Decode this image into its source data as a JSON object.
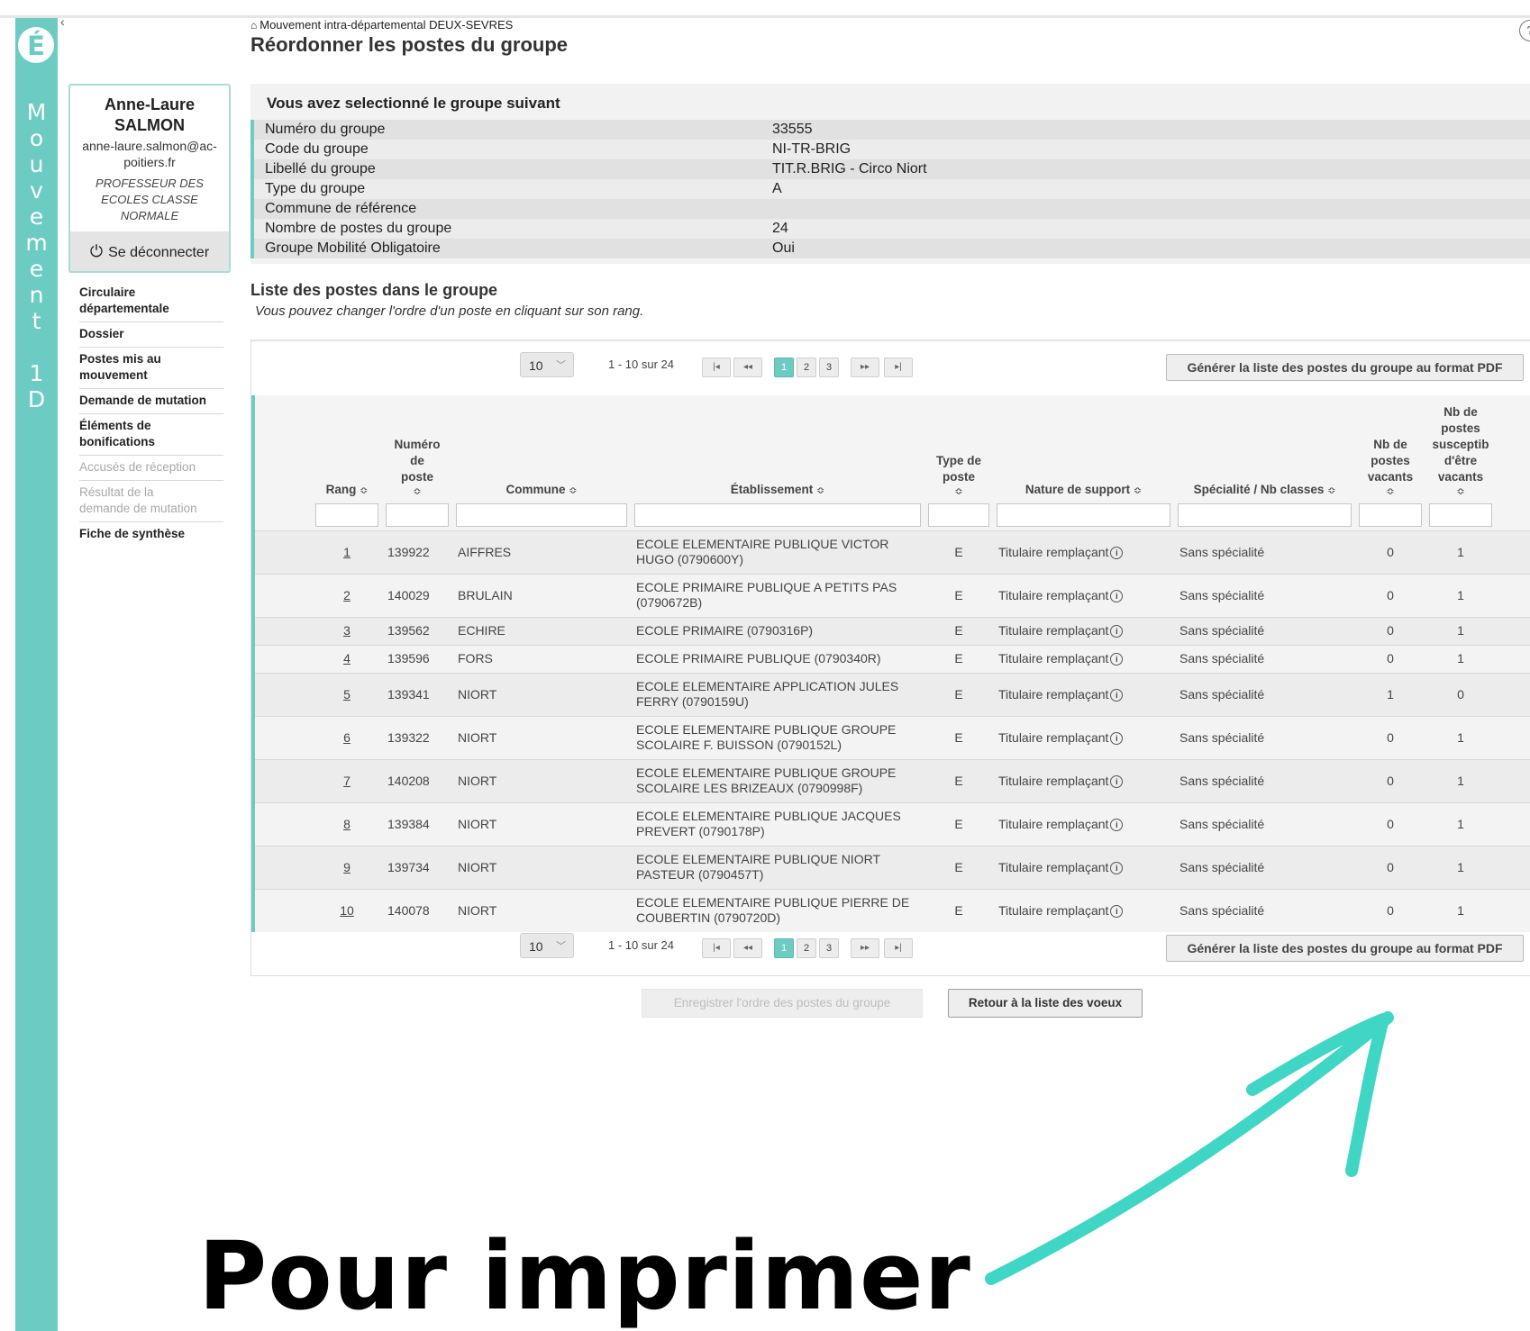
{
  "sidebar": {
    "logo": "É",
    "vertical_letters": [
      "M",
      "o",
      "u",
      "v",
      "e",
      "m",
      "e",
      "n",
      "t",
      "",
      "1",
      "D"
    ],
    "collapse_label": "‹",
    "user": {
      "first_name": "Anne-Laure",
      "last_name": "SALMON",
      "email_line1": "anne-laure.salmon@ac-",
      "email_line2": "poitiers.fr",
      "role_line1": "PROFESSEUR DES",
      "role_line2": "ECOLES CLASSE",
      "role_line3": "NORMALE",
      "logout_label": "Se déconnecter"
    },
    "nav": [
      {
        "line1": "Circulaire",
        "line2": "départementale"
      },
      {
        "line1": "Dossier",
        "line2": ""
      },
      {
        "line1": "Postes mis au",
        "line2": "mouvement"
      },
      {
        "line1": "Demande de mutation",
        "line2": ""
      },
      {
        "line1": "Éléments de",
        "line2": "bonifications"
      },
      {
        "line1": "Accusés de réception",
        "line2": ""
      },
      {
        "line1": "Résultat de la",
        "line2": "demande de mutation"
      },
      {
        "line1": "Fiche de synthèse",
        "line2": ""
      }
    ]
  },
  "header": {
    "breadcrumb": "Mouvement intra-départemental DEUX-SEVRES",
    "title": "Réordonner les postes du groupe",
    "help": "?"
  },
  "group": {
    "heading": "Vous avez selectionné le groupe suivant",
    "rows": [
      {
        "label": "Numéro du groupe",
        "value": "33555"
      },
      {
        "label": "Code du groupe",
        "value": "NI-TR-BRIG"
      },
      {
        "label": "Libellé du groupe",
        "value": "TIT.R.BRIG - Circo Niort"
      },
      {
        "label": "Type du groupe",
        "value": "A"
      },
      {
        "label": "Commune de référence",
        "value": ""
      },
      {
        "label": "Nombre de postes du groupe",
        "value": "24"
      },
      {
        "label": "Groupe Mobilité Obligatoire",
        "value": "Oui"
      }
    ]
  },
  "list": {
    "title": "Liste des postes dans le groupe",
    "subtitle": "Vous pouvez changer l'ordre d'un poste en cliquant sur son rang.",
    "pager": {
      "page_size": "10",
      "range_text": "1 - 10 sur 24",
      "pages": [
        "1",
        "2",
        "3"
      ],
      "first": "|◂",
      "prev": "◂◂",
      "next": "▸▸",
      "last": "▸|"
    },
    "pdf_button": "Générer la liste des postes du groupe au format PDF",
    "columns": {
      "rang": "Rang",
      "numero_l1": "Numéro",
      "numero_l2": "de",
      "numero_l3": "poste",
      "commune": "Commune",
      "etablissement": "Établissement",
      "type_l1": "Type de",
      "type_l2": "poste",
      "nature": "Nature de support",
      "specialite": "Spécialité / Nb classes",
      "vacants_l1": "Nb de",
      "vacants_l2": "postes",
      "vacants_l3": "vacants",
      "susc_l1": "Nb de",
      "susc_l2": "postes",
      "susc_l3": "susceptib",
      "susc_l4": "d'être",
      "susc_l5": "vacants",
      "sort_icon": "≎"
    },
    "rows": [
      {
        "rang": "1",
        "numero": "139922",
        "commune": "AIFFRES",
        "etab_l1": "ECOLE ELEMENTAIRE PUBLIQUE VICTOR",
        "etab_l2": "HUGO (0790600Y)",
        "type": "E",
        "nature": "Titulaire remplaçant",
        "specialite": "Sans spécialité",
        "vacants": "0",
        "susceptibles": "1"
      },
      {
        "rang": "2",
        "numero": "140029",
        "commune": "BRULAIN",
        "etab_l1": "ECOLE PRIMAIRE PUBLIQUE A PETITS PAS",
        "etab_l2": "(0790672B)",
        "type": "E",
        "nature": "Titulaire remplaçant",
        "specialite": "Sans spécialité",
        "vacants": "0",
        "susceptibles": "1"
      },
      {
        "rang": "3",
        "numero": "139562",
        "commune": "ECHIRE",
        "etab_l1": "ECOLE PRIMAIRE (0790316P)",
        "etab_l2": "",
        "type": "E",
        "nature": "Titulaire remplaçant",
        "specialite": "Sans spécialité",
        "vacants": "0",
        "susceptibles": "1"
      },
      {
        "rang": "4",
        "numero": "139596",
        "commune": "FORS",
        "etab_l1": "ECOLE PRIMAIRE PUBLIQUE (0790340R)",
        "etab_l2": "",
        "type": "E",
        "nature": "Titulaire remplaçant",
        "specialite": "Sans spécialité",
        "vacants": "0",
        "susceptibles": "1"
      },
      {
        "rang": "5",
        "numero": "139341",
        "commune": "NIORT",
        "etab_l1": "ECOLE ELEMENTAIRE APPLICATION JULES",
        "etab_l2": "FERRY (0790159U)",
        "type": "E",
        "nature": "Titulaire remplaçant",
        "specialite": "Sans spécialité",
        "vacants": "1",
        "susceptibles": "0"
      },
      {
        "rang": "6",
        "numero": "139322",
        "commune": "NIORT",
        "etab_l1": "ECOLE ELEMENTAIRE PUBLIQUE GROUPE",
        "etab_l2": "SCOLAIRE F. BUISSON (0790152L)",
        "type": "E",
        "nature": "Titulaire remplaçant",
        "specialite": "Sans spécialité",
        "vacants": "0",
        "susceptibles": "1"
      },
      {
        "rang": "7",
        "numero": "140208",
        "commune": "NIORT",
        "etab_l1": "ECOLE ELEMENTAIRE PUBLIQUE GROUPE",
        "etab_l2": "SCOLAIRE LES BRIZEAUX (0790998F)",
        "type": "E",
        "nature": "Titulaire remplaçant",
        "specialite": "Sans spécialité",
        "vacants": "0",
        "susceptibles": "1"
      },
      {
        "rang": "8",
        "numero": "139384",
        "commune": "NIORT",
        "etab_l1": "ECOLE ELEMENTAIRE PUBLIQUE JACQUES",
        "etab_l2": "PREVERT (0790178P)",
        "type": "E",
        "nature": "Titulaire remplaçant",
        "specialite": "Sans spécialité",
        "vacants": "0",
        "susceptibles": "1"
      },
      {
        "rang": "9",
        "numero": "139734",
        "commune": "NIORT",
        "etab_l1": "ECOLE ELEMENTAIRE PUBLIQUE NIORT",
        "etab_l2": "PASTEUR (0790457T)",
        "type": "E",
        "nature": "Titulaire remplaçant",
        "specialite": "Sans spécialité",
        "vacants": "0",
        "susceptibles": "1"
      },
      {
        "rang": "10",
        "numero": "140078",
        "commune": "NIORT",
        "etab_l1": "ECOLE ELEMENTAIRE PUBLIQUE PIERRE DE",
        "etab_l2": "COUBERTIN (0790720D)",
        "type": "E",
        "nature": "Titulaire remplaçant",
        "specialite": "Sans spécialité",
        "vacants": "0",
        "susceptibles": "1"
      }
    ]
  },
  "actions": {
    "save": "Enregistrer l'ordre des postes du groupe",
    "back": "Retour à la liste des voeux"
  },
  "overlay": {
    "text": "Pour imprimer",
    "arrow_color": "#3fd6c6"
  }
}
